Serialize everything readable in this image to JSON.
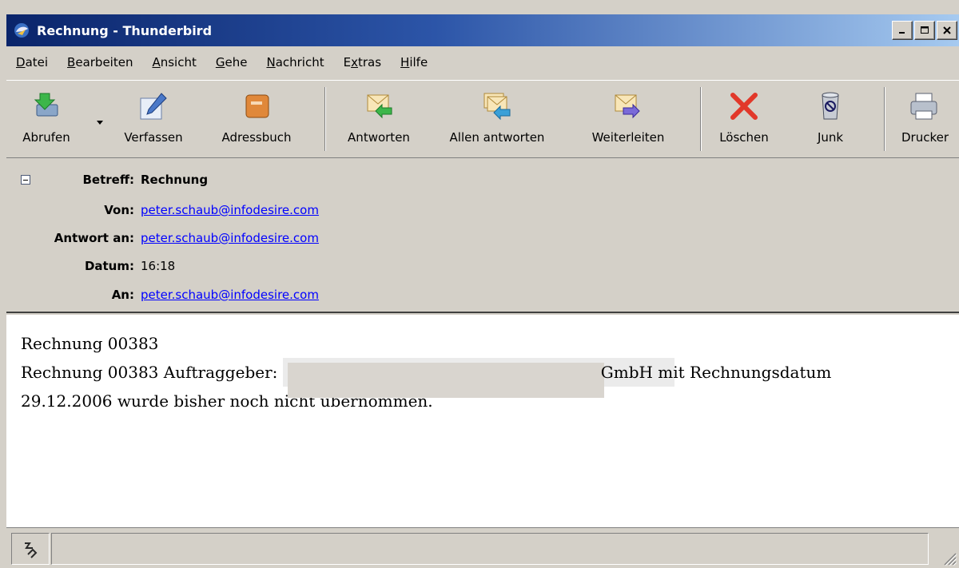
{
  "window": {
    "title": "Rechnung - Thunderbird",
    "app_icon": "thunderbird-icon",
    "controls": [
      "minimize-icon",
      "maximize-icon",
      "close-icon"
    ]
  },
  "menubar": {
    "items": [
      {
        "label_pre": "",
        "accel": "D",
        "label_post": "atei"
      },
      {
        "label_pre": "",
        "accel": "B",
        "label_post": "earbeiten"
      },
      {
        "label_pre": "",
        "accel": "A",
        "label_post": "nsicht"
      },
      {
        "label_pre": "",
        "accel": "G",
        "label_post": "ehe"
      },
      {
        "label_pre": "",
        "accel": "N",
        "label_post": "achricht"
      },
      {
        "label_pre": "E",
        "accel": "x",
        "label_post": "tras"
      },
      {
        "label_pre": "",
        "accel": "H",
        "label_post": "ilfe"
      }
    ]
  },
  "toolbar": {
    "buttons": [
      {
        "label": "Abrufen",
        "icon": "get-mail-icon"
      },
      {
        "label": "Verfassen",
        "icon": "compose-icon"
      },
      {
        "label": "Adressbuch",
        "icon": "address-book-icon"
      },
      {
        "label": "Antworten",
        "icon": "reply-icon"
      },
      {
        "label": "Allen antworten",
        "icon": "reply-all-icon"
      },
      {
        "label": "Weiterleiten",
        "icon": "forward-icon"
      },
      {
        "label": "Löschen",
        "icon": "delete-icon"
      },
      {
        "label": "Junk",
        "icon": "junk-icon"
      },
      {
        "label": "Drucker",
        "icon": "print-icon"
      }
    ]
  },
  "header": {
    "subject_label": "Betreff:",
    "subject": "Rechnung",
    "from_label": "Von:",
    "from": "peter.schaub@infodesire.com",
    "reply_to_label": "Antwort an:",
    "reply_to": "peter.schaub@infodesire.com",
    "date_label": "Datum:",
    "date": "16:18",
    "to_label": "An:",
    "to": "peter.schaub@infodesire.com"
  },
  "message": {
    "line1": "Rechnung 00383",
    "line2_pre": "Rechnung 00383 Auftraggeber:",
    "line2_post": "GmbH mit Rechnungsdatum",
    "line3": "29.12.2006 wurde bisher noch nicht übernommen."
  },
  "statusbar": {
    "status_icon": "online-status-icon",
    "text": ""
  },
  "colors": {
    "titlebar_start": "#0a246a",
    "titlebar_end": "#a6caf0",
    "chrome": "#d4d0c8",
    "link": "#0000ff"
  }
}
